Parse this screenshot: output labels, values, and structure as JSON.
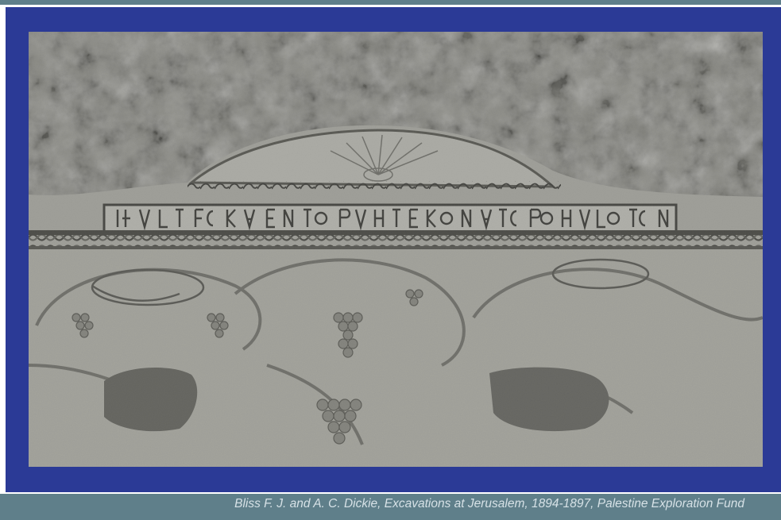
{
  "slide": {
    "frame_color": "#2b3a96",
    "caption_bar_color": "#5f7f8a",
    "caption_text_color": "#d6e1e6"
  },
  "photo": {
    "subject": "black-and-white photograph of an excavated mosaic floor with an inscription band, braided border and vine scrolls"
  },
  "caption": {
    "text": "Bliss F. J. and A. C. Dickie, Excavations at Jerusalem, 1894-1897, Palestine Exploration Fund"
  }
}
